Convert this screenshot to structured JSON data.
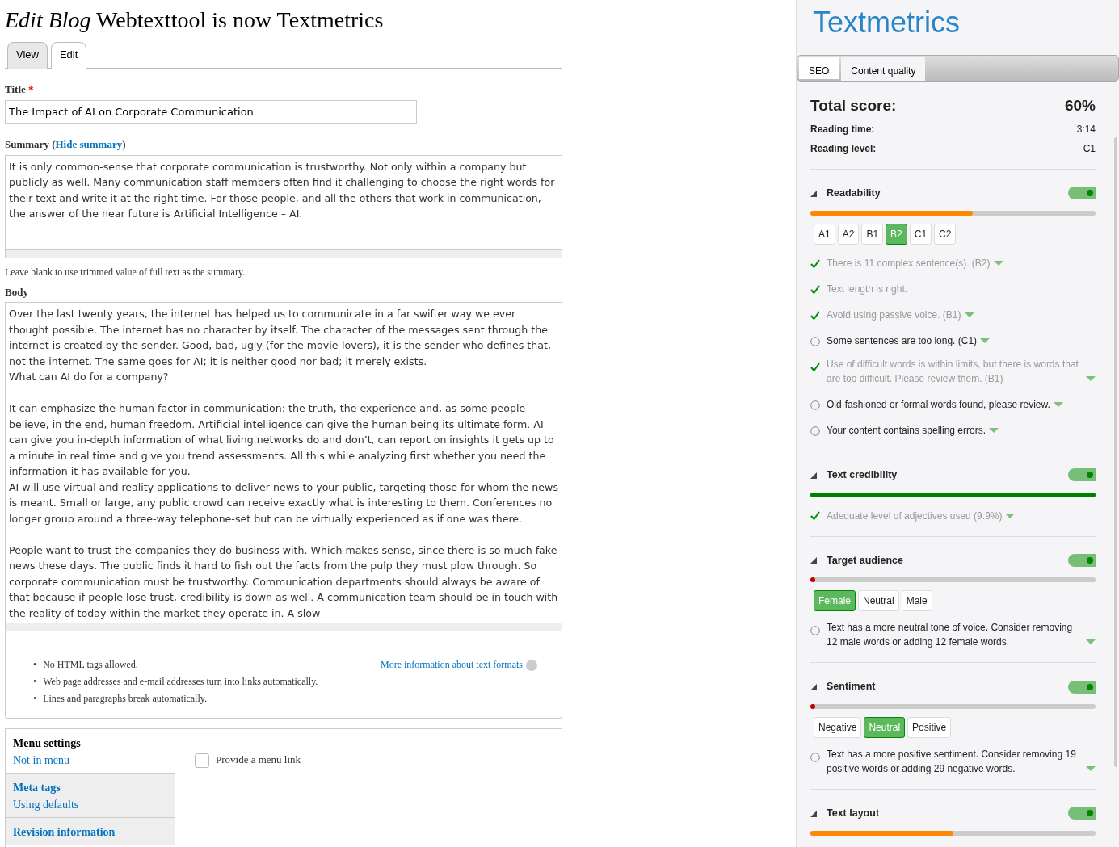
{
  "page_title": {
    "prefix": "Edit Blog",
    "name": "Webtexttool is now Textmetrics"
  },
  "tabs": [
    {
      "label": "View",
      "selected": false
    },
    {
      "label": "Edit",
      "selected": true
    }
  ],
  "title_field": {
    "label": "Title",
    "required_mark": "*",
    "value": "The Impact of AI on Corporate Communication"
  },
  "summary": {
    "label": "Summary",
    "brackets": [
      "(",
      ")"
    ],
    "link": "Hide summary",
    "value": "It is only common-sense that corporate communication is trustworthy. Not only within a company but publicly as well. Many communication staff members often find it challenging to choose the right words for their text and write it at the right time. For those people, and all the others that work in communication, the answer of the near future is Artificial Intelligence – AI.",
    "help": "Leave blank to use trimmed value of full text as the summary."
  },
  "body": {
    "label": "Body",
    "value": "Over the last twenty years, the internet has helped us to communicate in a far swifter way we ever thought possible. The internet has no character by itself. The character of the messages sent through the internet is created by the sender. Good, bad, ugly (for the movie-lovers), it is the sender who defines that, not the internet. The same goes for AI; it is neither good nor bad; it merely exists.\nWhat can AI do for a company?\n\nIt can emphasize the human factor in communication: the truth, the experience and, as some people believe, in the end, human freedom. Artificial intelligence can give the human being its ultimate form. AI can give you in-depth information of what living networks do and don’t, can report on insights it gets up to a minute in real time and give you trend assessments. All this while analyzing first whether you need the information it has available for you.\nAI will use virtual and reality applications to deliver news to your public, targeting those for whom the news is meant. Small or large, any public crowd can receive exactly what is interesting to them. Conferences no longer group around a three-way telephone-set but can be virtually experienced as if one was there.\n\nPeople want to trust the companies they do business with. Which makes sense, since there is so much fake news these days. The public finds it hard to fish out the facts from the pulp they must plow through. So corporate communication must be trustworthy. Communication departments should always be aware of that because if people lose trust, credibility is down as well. A communication team should be in touch with the reality of today within the market they operate in. A slow"
  },
  "format_tips": [
    {
      "marker": "•",
      "text": "No HTML tags allowed."
    },
    {
      "marker": "•",
      "text": "Web page addresses and e-mail addresses turn into links automatically."
    },
    {
      "marker": "•",
      "text": "Lines and paragraphs break automatically."
    }
  ],
  "format_link": "More information about text formats",
  "vertical_tabs": [
    {
      "title": "Menu settings",
      "summary": "Not in menu",
      "selected": true
    },
    {
      "title": "Meta tags",
      "summary": "Using defaults",
      "selected": false
    },
    {
      "title": "Revision information",
      "selected": false
    }
  ],
  "menu_checkbox": {
    "label": "Provide a menu link",
    "checked": false
  },
  "sidebar": {
    "logo": "Textmetrics",
    "tabs": [
      {
        "label": "SEO",
        "selected": false
      },
      {
        "label": "Content quality",
        "selected": true
      }
    ],
    "total_score": {
      "label": "Total score:",
      "value": "60%"
    },
    "stats": [
      {
        "label": "Reading time:",
        "value": "3:14"
      },
      {
        "label": "Reading level:",
        "value": "C1"
      }
    ],
    "sections": [
      {
        "title": "Readability",
        "on": true,
        "level": 0.57,
        "color": "#ff8800",
        "options": [
          {
            "label": "A1",
            "selected": false
          },
          {
            "label": "A2",
            "selected": false
          },
          {
            "label": "B1",
            "selected": false
          },
          {
            "label": "B2",
            "selected": true
          },
          {
            "label": "C1",
            "selected": false
          },
          {
            "label": "C2",
            "selected": false
          }
        ],
        "checks": [
          {
            "text": "There is 11 complex sentence(s). (B2)",
            "done": true
          },
          {
            "text": "Text length is right.",
            "done": true,
            "caret": false
          },
          {
            "text": "Avoid using passive voice. (B1)",
            "done": true
          },
          {
            "text": "Some sentences are too long. (C1)",
            "done": false
          },
          {
            "text": "Use of difficult words is within limits, but there is words that are too difficult. Please review them. (B1)",
            "done": true
          },
          {
            "text": "Old-fashioned or formal words found, please review.",
            "done": false
          },
          {
            "text": "Your content contains spelling errors.",
            "done": false
          }
        ]
      },
      {
        "title": "Text credibility",
        "on": true,
        "level": 1,
        "color": "#008000",
        "checks": [
          {
            "text": "Adequate level of adjectives used (9.9%)",
            "done": true
          }
        ]
      },
      {
        "title": "Target audience",
        "on": true,
        "level": 0.01,
        "color": "#c00000",
        "options": [
          {
            "label": "Female",
            "selected": true
          },
          {
            "label": "Neutral",
            "selected": false
          },
          {
            "label": "Male",
            "selected": false
          }
        ],
        "checks": [
          {
            "text": "Text has a more neutral tone of voice. Consider removing 12 male words or adding 12 female words.",
            "done": false
          }
        ]
      },
      {
        "title": "Sentiment",
        "on": true,
        "level": 0.01,
        "color": "#c00000",
        "options": [
          {
            "label": "Negative",
            "selected": false
          },
          {
            "label": "Neutral",
            "selected": true
          },
          {
            "label": "Positive",
            "selected": false
          }
        ],
        "checks": [
          {
            "text": "Text has a more positive sentiment. Consider removing 19 positive words or adding 29 negative words.",
            "done": false
          }
        ]
      },
      {
        "title": "Text layout",
        "on": true,
        "level": 0.5,
        "color": "#ff8800"
      }
    ]
  }
}
